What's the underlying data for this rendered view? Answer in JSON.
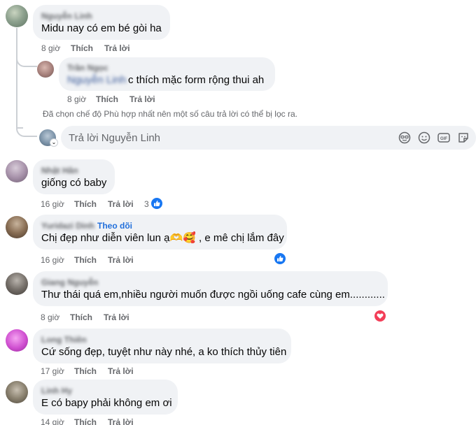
{
  "comments": [
    {
      "author": "Nguyễn Linh",
      "text": "Midu nay có em bé gòi ha",
      "time": "8 giờ",
      "like": "Thích",
      "reply": "Trả lời"
    },
    {
      "author": "Trần Ngọc",
      "mention": "Nguyễn Linh",
      "text": "c thích mặc form rộng thui ah",
      "time": "8 giờ",
      "like": "Thích",
      "reply": "Trả lời"
    },
    {
      "author": "Nhật Hân",
      "text": "giống có baby",
      "time": "16 giờ",
      "like": "Thích",
      "reply": "Trả lời",
      "reaction_count": "3"
    },
    {
      "author": "Yuridazi Dinh",
      "follow": "Theo dõi",
      "text": "Chị đẹp như diễn viên lun ạ🫶🥰 , e mê chị lắm đây",
      "time": "16 giờ",
      "like": "Thích",
      "reply": "Trả lời"
    },
    {
      "author": "Giang Nguyễn",
      "text": "Thư thái quá em,nhiều người muốn được ngồi uống cafe cùng em............",
      "time": "8 giờ",
      "like": "Thích",
      "reply": "Trả lời"
    },
    {
      "author": "Long Thiên",
      "text": "Cứ sống đẹp, tuyệt như này nhé, a ko thích thủy tiên",
      "time": "17 giờ",
      "like": "Thích",
      "reply": "Trả lời"
    },
    {
      "author": "Linh Hy",
      "text": "E có bapy phải không em ơi",
      "time": "14 giờ",
      "like": "Thích",
      "reply": "Trả lời"
    }
  ],
  "filter_notice": "Đã chọn chế độ Phù hợp nhất nên một số câu trả lời có thể bị lọc ra.",
  "reply_input": {
    "placeholder": "Trả lời Nguyễn Linh"
  },
  "colors": {
    "bubble": "#f0f2f5",
    "meta": "#65676b",
    "link": "#216fdb",
    "like_blue": "#1877f2",
    "love_red": "#f33e58"
  },
  "icons": [
    "emoji-avatar-icon",
    "smile-icon",
    "gif-icon",
    "sticker-icon",
    "like-reaction-icon",
    "love-reaction-icon",
    "chevron-down-icon"
  ]
}
